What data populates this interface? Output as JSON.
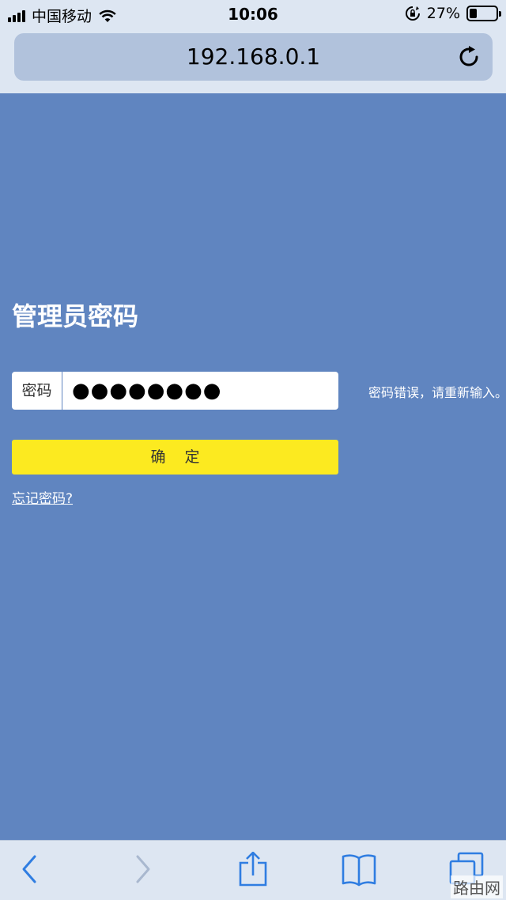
{
  "status_bar": {
    "carrier": "中国移动",
    "time": "10:06",
    "battery_percent": "27%",
    "battery_level": 0.27,
    "icons": [
      "signal-icon",
      "wifi-icon",
      "rotation-lock-icon",
      "battery-icon"
    ]
  },
  "browser": {
    "url": "192.168.0.1",
    "reload_icon": "reload-icon"
  },
  "login": {
    "title": "管理员密码",
    "password_label": "密码",
    "password_value": "●●●●●●●●",
    "error_message": "密码错误，请重新输入。",
    "confirm_label": "确定",
    "forgot_link": "忘记密码?"
  },
  "toolbar": {
    "icons": [
      "back-icon",
      "forward-icon",
      "share-icon",
      "bookmarks-icon",
      "tabs-icon"
    ]
  },
  "watermark": "路由网",
  "colors": {
    "background": "#6085c0",
    "button": "#fcea20",
    "bars": "#dde6f2",
    "url_field": "#b1c2dc",
    "icon_blue": "#2f7de1"
  }
}
